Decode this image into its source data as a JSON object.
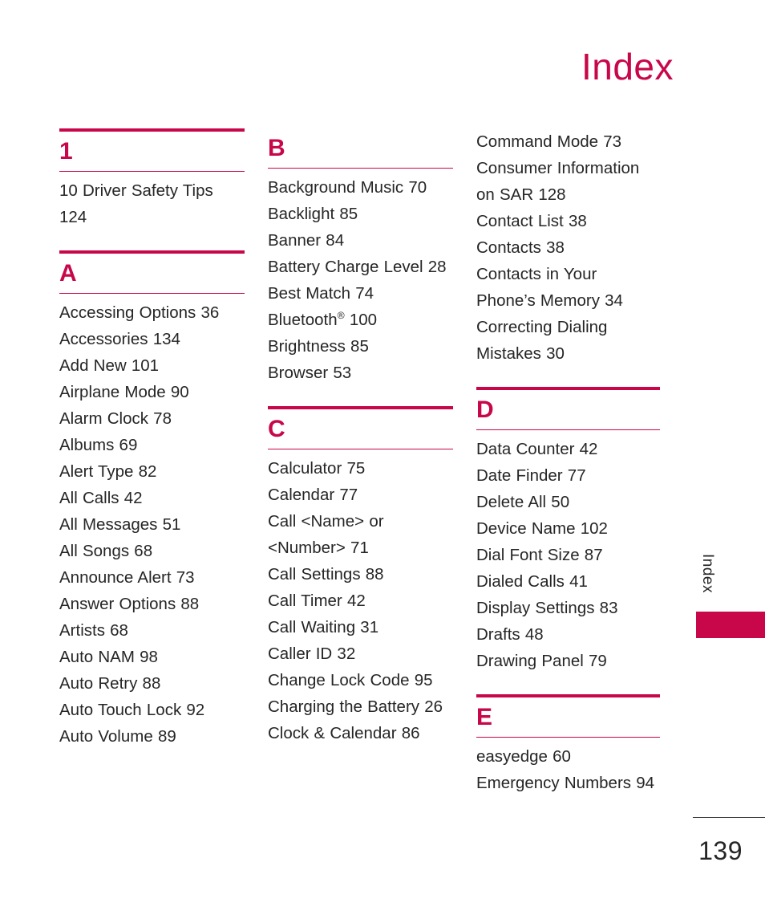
{
  "header": {
    "title": "Index"
  },
  "side_tab": {
    "label": "Index"
  },
  "footer": {
    "page_number": "139"
  },
  "colors": {
    "accent": "#c8074b",
    "text": "#262626"
  },
  "columns": [
    {
      "id": "column-1",
      "sections": [
        {
          "letter": "1",
          "has_top_rule": true,
          "entries": [
            "10 Driver Safety Tips 124"
          ]
        },
        {
          "letter": "A",
          "has_top_rule": true,
          "entries": [
            "Accessing Options 36",
            "Accessories 134",
            "Add New 101",
            "Airplane Mode 90",
            "Alarm Clock 78",
            "Albums 69",
            "Alert Type 82",
            "All Calls 42",
            "All Messages 51",
            "All Songs 68",
            "Announce Alert 73",
            "Answer Options 88",
            "Artists 68",
            "Auto NAM 98",
            "Auto Retry 88",
            "Auto Touch Lock 92",
            "Auto Volume 89"
          ]
        }
      ]
    },
    {
      "id": "column-2",
      "sections": [
        {
          "letter": "B",
          "has_top_rule": false,
          "entries": [
            "Background Music 70",
            "Backlight 85",
            "Banner 84",
            "Battery Charge Level 28",
            "Best Match 74",
            "Bluetooth® 100",
            "Brightness 85",
            "Browser 53"
          ]
        },
        {
          "letter": "C",
          "has_top_rule": true,
          "entries": [
            "Calculator 75",
            "Calendar 77",
            "Call <Name> or <Number> 71",
            "Call Settings 88",
            "Call Timer 42",
            "Call Waiting 31",
            "Caller ID 32",
            "Change Lock Code 95",
            "Charging the Battery 26",
            "Clock & Calendar 86"
          ]
        }
      ]
    },
    {
      "id": "column-3",
      "sections": [
        {
          "letter": null,
          "has_top_rule": false,
          "entries": [
            "Command Mode 73",
            "Consumer Information on SAR 128",
            "Contact List 38",
            "Contacts 38",
            "Contacts in Your Phone’s Memory 34",
            "Correcting Dialing Mistakes 30"
          ]
        },
        {
          "letter": "D",
          "has_top_rule": true,
          "entries": [
            "Data Counter 42",
            "Date Finder 77",
            "Delete All 50",
            "Device Name 102",
            "Dial Font Size 87",
            "Dialed Calls 41",
            "Display Settings 83",
            "Drafts 48",
            "Drawing Panel 79"
          ]
        },
        {
          "letter": "E",
          "has_top_rule": true,
          "entries": [
            "easyedge 60",
            "Emergency Numbers 94"
          ]
        }
      ]
    }
  ]
}
